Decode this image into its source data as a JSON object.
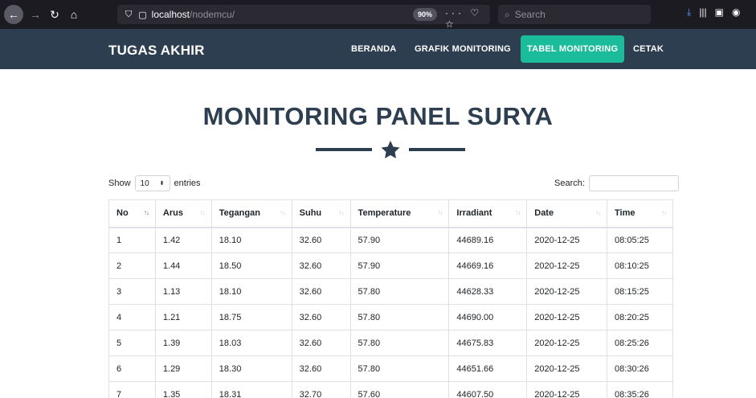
{
  "browser": {
    "url_host": "localhost",
    "url_path": "/nodemcu/",
    "zoom": "90%",
    "search_placeholder": "Search"
  },
  "navbar": {
    "brand": "TUGAS AKHIR",
    "links": [
      "BERANDA",
      "GRAFIK MONITORING",
      "TABEL MONITORING",
      "CETAK"
    ],
    "active_link": "TABEL MONITORING"
  },
  "page": {
    "title": "MONITORING PANEL SURYA"
  },
  "table_controls": {
    "show_label": "Show",
    "entries_value": "10",
    "entries_label": "entries",
    "search_label": "Search:"
  },
  "table": {
    "columns": [
      "No",
      "Arus",
      "Tegangan",
      "Suhu",
      "Temperature",
      "Irradiant",
      "Date",
      "Time"
    ],
    "rows": [
      [
        "1",
        "1.42",
        "18.10",
        "32.60",
        "57.90",
        "44689.16",
        "2020-12-25",
        "08:05:25"
      ],
      [
        "2",
        "1.44",
        "18.50",
        "32.60",
        "57.90",
        "44669.16",
        "2020-12-25",
        "08:10:25"
      ],
      [
        "3",
        "1.13",
        "18.10",
        "32.60",
        "57.80",
        "44628.33",
        "2020-12-25",
        "08:15:25"
      ],
      [
        "4",
        "1.21",
        "18.75",
        "32.60",
        "57.80",
        "44690.00",
        "2020-12-25",
        "08:20:25"
      ],
      [
        "5",
        "1.39",
        "18.03",
        "32.60",
        "57.80",
        "44675.83",
        "2020-12-25",
        "08:25:26"
      ],
      [
        "6",
        "1.29",
        "18.30",
        "32.60",
        "57.80",
        "44651.66",
        "2020-12-25",
        "08:30:26"
      ],
      [
        "7",
        "1.35",
        "18.31",
        "32.70",
        "57.60",
        "44607.50",
        "2020-12-25",
        "08:35:26"
      ]
    ]
  },
  "colors": {
    "navbar": "#2c3e50",
    "accent": "#1abc9c",
    "chrome": "#1c1b22"
  }
}
